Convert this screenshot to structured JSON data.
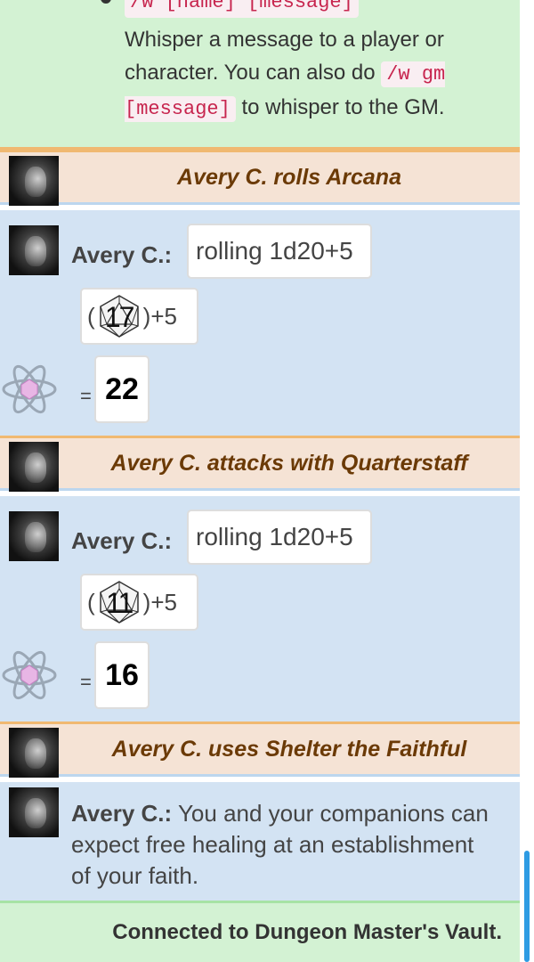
{
  "help": {
    "command_top": "/w [name] [message]",
    "text_1": "Whisper a message to a player or character. You can also do ",
    "code": "/w gm [message]",
    "text_2": " to whisper to the GM."
  },
  "entries": [
    {
      "header": "Avery C. rolls Arcana",
      "sender": "Avery C.:",
      "roll_label": "rolling 1d20+5",
      "open_paren": "(",
      "die_value": "17",
      "modifier": ")+5",
      "equals": "=",
      "total": "22"
    },
    {
      "header": "Avery C. attacks with Quarterstaff",
      "sender": "Avery C.:",
      "roll_label": "rolling 1d20+5",
      "open_paren": "(",
      "die_value": "11",
      "modifier": ")+5",
      "equals": "=",
      "total": "16"
    }
  ],
  "feature": {
    "header": "Avery C. uses Shelter the Faithful",
    "sender": "Avery C.:",
    "text": "You and your companions can expect free healing at an establishment of your faith."
  },
  "footer": {
    "status": "Connected to Dungeon Master's Vault."
  },
  "colors": {
    "help_bg": "#d3f2d3",
    "header_bg": "#f5e3d5",
    "header_text": "#6b3a06",
    "message_bg": "#d3e3f3",
    "code_text": "#c7254e",
    "scrollbar": "#2e9be3"
  },
  "icons": {
    "avatar": "user-avatar-photo",
    "die": "d20-die-icon",
    "crit": "atom-icon"
  }
}
